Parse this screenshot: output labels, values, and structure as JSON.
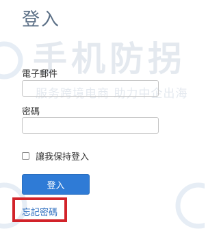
{
  "page": {
    "title": "登入"
  },
  "form": {
    "email_label": "電子郵件",
    "email_value": "",
    "password_label": "密碼",
    "password_value": "",
    "remember_label": "讓我保持登入",
    "remember_checked": false,
    "login_button": "登入",
    "forgot_link": "忘記密碼"
  },
  "watermark": {
    "line1": "手机防拐",
    "line2": "服务跨境电商 助力中企出海"
  },
  "colors": {
    "title": "#5b6f86",
    "button": "#2f7bd6",
    "link": "#2f6fc0",
    "highlight_box": "#d2232a"
  }
}
